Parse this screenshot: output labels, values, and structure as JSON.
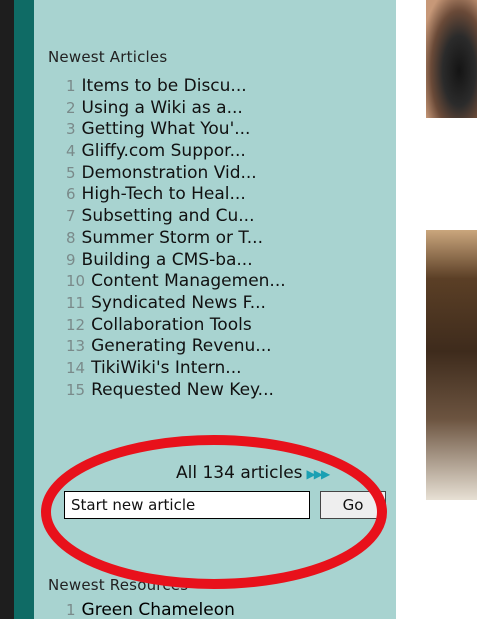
{
  "sidebar": {
    "newest_articles_heading": "Newest Articles",
    "articles": [
      {
        "num": "1",
        "title": "Items to be Discu..."
      },
      {
        "num": "2",
        "title": "Using a Wiki as a..."
      },
      {
        "num": "3",
        "title": "Getting What You'..."
      },
      {
        "num": "4",
        "title": "Gliffy.com Suppor..."
      },
      {
        "num": "5",
        "title": "Demonstration Vid..."
      },
      {
        "num": "6",
        "title": "High-Tech to Heal..."
      },
      {
        "num": "7",
        "title": "Subsetting and Cu..."
      },
      {
        "num": "8",
        "title": "Summer Storm or T..."
      },
      {
        "num": "9",
        "title": "Building a CMS-ba..."
      },
      {
        "num": "10",
        "title": "Content Managemen..."
      },
      {
        "num": "11",
        "title": "Syndicated News F..."
      },
      {
        "num": "12",
        "title": "Collaboration Tools"
      },
      {
        "num": "13",
        "title": "Generating Revenu..."
      },
      {
        "num": "14",
        "title": "TikiWiki's Intern..."
      },
      {
        "num": "15",
        "title": "Requested New Key..."
      }
    ],
    "all_articles_label": "All 134 articles",
    "all_articles_icon": "triple-arrow-right-icon",
    "new_article_input_value": "Start new article",
    "go_button_label": "Go",
    "newest_resources_heading": "Newest Resources",
    "resources": [
      {
        "num": "1",
        "title": "Green Chameleon"
      }
    ]
  },
  "annotation_color": "#e8111b"
}
